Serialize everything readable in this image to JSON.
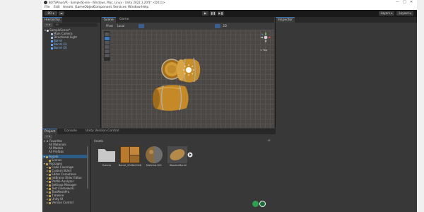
{
  "window": {
    "title": "BOTSPlaysVR - SampleScene - Windows, Mac, Linux - Unity 2022.3.20f1* <DX11>",
    "controls": [
      "—",
      "□",
      "✕"
    ]
  },
  "menu": [
    "File",
    "Edit",
    "Assets",
    "GameObject",
    "Component",
    "Services",
    "Window",
    "Help"
  ],
  "toolbar": {
    "account": "BO ▾",
    "cloud": "☁",
    "play": "▶",
    "pause": "❚❚",
    "step": "▶❚",
    "layers": "Layers ▾",
    "layout": "Layout ▾"
  },
  "hierarchy": {
    "tab": "Hierarchy",
    "add": "+ ▾",
    "search_placeholder": "All",
    "items": [
      {
        "label": "SampleScene*",
        "selected": false
      },
      {
        "label": "Main Camera",
        "selected": false
      },
      {
        "label": "Directional Light",
        "selected": false
      },
      {
        "label": "Barrel",
        "selected": false
      },
      {
        "label": "Barrel (1)",
        "selected": false
      },
      {
        "label": "Barrel (2)",
        "selected": false
      }
    ]
  },
  "scene": {
    "tabs": [
      "Scene",
      "Game"
    ],
    "shading": "Pivot",
    "space": "Local",
    "view": "2D",
    "persp": "< Top"
  },
  "inspector": {
    "tab": "Inspector"
  },
  "project": {
    "tabs": [
      "Project",
      "Console",
      "Unity Version Control"
    ],
    "add": "+ ▾",
    "favorites": {
      "label": "Favorites",
      "items": [
        "All Materials",
        "All Models",
        "All Prefabs"
      ]
    },
    "assets": {
      "label": "Assets",
      "items": [
        "Scenes"
      ]
    },
    "packages": {
      "label": "Packages",
      "items": [
        "Code Coverage",
        "Custom NUnit",
        "Editor Coroutines",
        "JetBrains Rider Editor",
        "Profile Analyzer",
        "Settings Manager",
        "Test Framework",
        "TextMeshPro",
        "Timeline",
        "Unity UI",
        "Version Control"
      ]
    },
    "breadcrumb": "Assets",
    "grid_items": [
      {
        "label": "Scenes",
        "kind": "folder"
      },
      {
        "label": "Barrel_2048x2048",
        "kind": "texture"
      },
      {
        "label": "Material.001",
        "kind": "material"
      },
      {
        "label": "WoodenBarrel",
        "kind": "model"
      }
    ],
    "count": "16"
  },
  "colors": {
    "panel": "#383838",
    "toolbar": "#191919",
    "selection_blue": "#4a9cf0",
    "barrel_wood": "#c9952e",
    "barrel_band": "#b3b3b3"
  }
}
